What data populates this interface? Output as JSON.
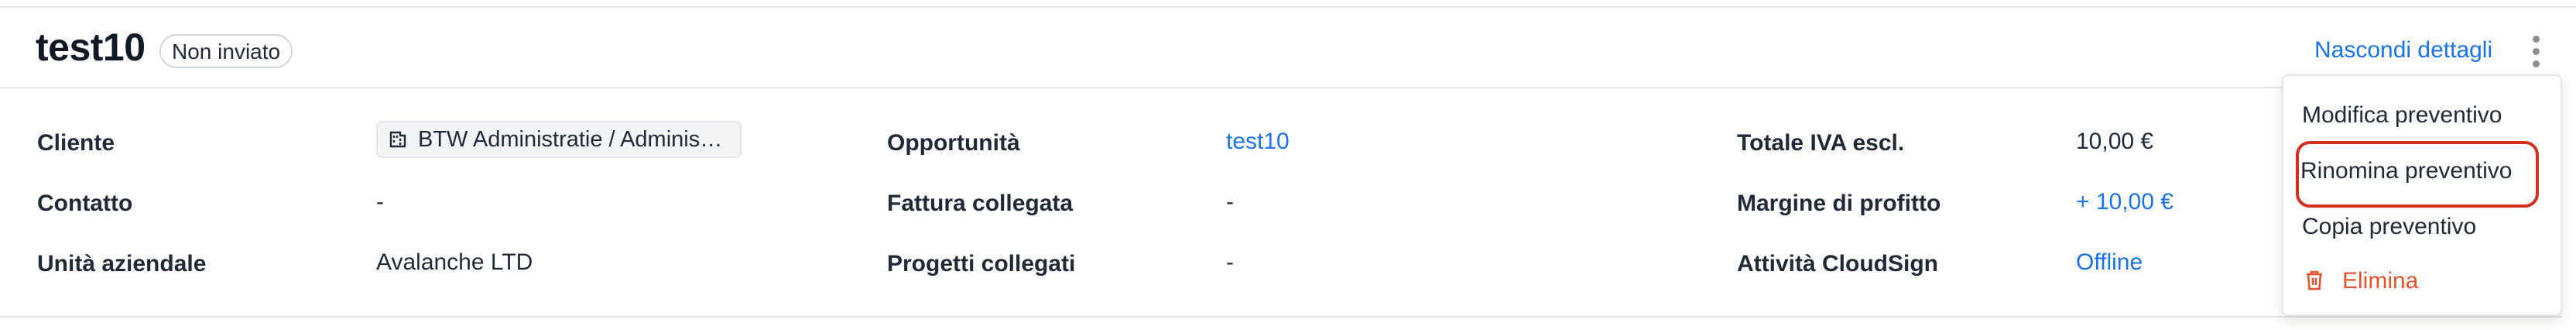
{
  "header": {
    "title": "test10",
    "status": "Non inviato",
    "hide_details": "Nascondi dettagli"
  },
  "details": {
    "col1": [
      {
        "label": "Cliente",
        "value": "BTW Administratie / Adminis…",
        "type": "chip"
      },
      {
        "label": "Contatto",
        "value": "-"
      },
      {
        "label": "Unità aziendale",
        "value": "Avalanche LTD"
      }
    ],
    "col2": [
      {
        "label": "Opportunità",
        "value": "test10",
        "type": "link"
      },
      {
        "label": "Fattura collegata",
        "value": "-"
      },
      {
        "label": "Progetti collegati",
        "value": "-"
      }
    ],
    "col3": [
      {
        "label": "Totale IVA escl.",
        "value": "10,00 €"
      },
      {
        "label": "Margine di profitto",
        "value": "+ 10,00 €",
        "type": "link"
      },
      {
        "label": "Attività CloudSign",
        "value": "Offline",
        "type": "link"
      }
    ]
  },
  "menu": {
    "items": [
      {
        "label": "Modifica preventivo"
      },
      {
        "label": "Rinomina preventivo",
        "highlighted": true
      },
      {
        "label": "Copia preventivo"
      },
      {
        "label": "Elimina",
        "danger": true,
        "icon": "trash-icon"
      }
    ]
  },
  "colors": {
    "accent": "#1a73e8",
    "danger": "#e5532b",
    "highlight": "#d32f1f",
    "border": "#e5e7eb"
  }
}
